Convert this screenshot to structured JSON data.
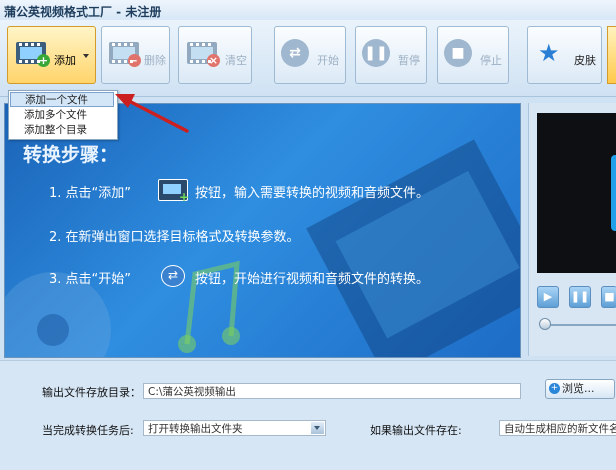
{
  "window": {
    "title": "蒲公英视频格式工厂 - 未注册"
  },
  "toolbar": {
    "add": "添加",
    "delete": "删除",
    "clear": "清空",
    "start": "开始",
    "pause": "暂停",
    "stop": "停止",
    "skin": "皮肤"
  },
  "add_menu": {
    "items": [
      "添加一个文件",
      "添加多个文件",
      "添加整个目录"
    ],
    "selected_index": 0
  },
  "steps": {
    "heading": "转换步骤：",
    "step1_a": "1. 点击“添加”",
    "step1_b": "按钮，输入需要转换的视频和音频文件。",
    "step2": "2. 在新弹出窗口选择目标格式及转换参数。",
    "step3_a": "3. 点击“开始”",
    "step3_b": "按钮，开始进行视频和音频文件的转换。"
  },
  "settings": {
    "output_dir_label": "输出文件存放目录：",
    "output_dir_value": "C:\\蒲公英视频输出",
    "browse": "浏览...",
    "after_done_label": "当完成转换任务后:",
    "after_done_value": "打开转换输出文件夹",
    "if_exists_label": "如果输出文件存在:",
    "if_exists_value": "自动生成相应的新文件名"
  },
  "icons": {
    "add": "film-add-icon",
    "delete": "film-delete-icon",
    "clear": "film-clear-icon",
    "start": "shuffle-start-icon",
    "pause": "pause-icon",
    "stop": "stop-icon",
    "skin": "star-icon",
    "browse": "browse-icon"
  },
  "colors": {
    "accent": "#ffd46b",
    "banner": "#2f8ee0",
    "menu_highlight": "#d3e6f8",
    "annotation_arrow": "#cc1f1f"
  }
}
